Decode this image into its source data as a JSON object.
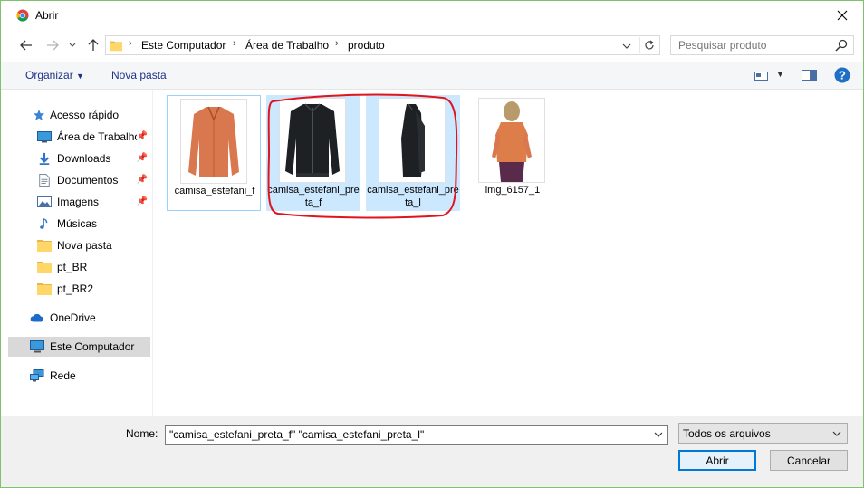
{
  "window": {
    "title": "Abrir"
  },
  "navbar": {
    "breadcrumbs": [
      "Este Computador",
      "Área de Trabalho",
      "produto"
    ],
    "search_placeholder": "Pesquisar produto"
  },
  "toolbar": {
    "organize_label": "Organizar",
    "new_folder_label": "Nova pasta"
  },
  "sidebar": {
    "items": [
      {
        "label": "Acesso rápido",
        "icon": "star-icon"
      },
      {
        "label": "Área de Trabalho",
        "icon": "desktop-icon",
        "pinned": true
      },
      {
        "label": "Downloads",
        "icon": "download-icon",
        "pinned": true
      },
      {
        "label": "Documentos",
        "icon": "document-icon",
        "pinned": true
      },
      {
        "label": "Imagens",
        "icon": "pictures-icon",
        "pinned": true
      },
      {
        "label": "Músicas",
        "icon": "music-icon"
      },
      {
        "label": "Nova pasta",
        "icon": "folder-icon"
      },
      {
        "label": "pt_BR",
        "icon": "folder-icon"
      },
      {
        "label": "pt_BR2",
        "icon": "folder-icon"
      },
      {
        "label": "OneDrive",
        "icon": "cloud-icon"
      },
      {
        "label": "Este Computador",
        "icon": "computer-icon",
        "selected": true
      },
      {
        "label": "Rede",
        "icon": "network-icon"
      }
    ]
  },
  "files": [
    {
      "name": "camisa_estefani_f",
      "selected": false
    },
    {
      "name": "camisa_estefani_preta_f",
      "selected": true
    },
    {
      "name": "camisa_estefani_preta_l",
      "selected": true
    },
    {
      "name": "img_6157_1",
      "selected": false
    }
  ],
  "bottom": {
    "name_label": "Nome:",
    "name_value": "\"camisa_estefani_preta_f\" \"camisa_estefani_preta_l\"",
    "filetype_value": "Todos os arquivos",
    "open_label": "Abrir",
    "cancel_label": "Cancelar"
  },
  "colors": {
    "accent": "#0078d7",
    "selection": "#cce8ff",
    "annotation": "#e0141e",
    "green_border": "#7ec36a"
  }
}
